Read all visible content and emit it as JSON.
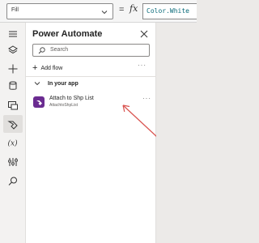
{
  "formula_bar": {
    "property": "Fill",
    "equals": "=",
    "fx": "fx",
    "formula": "Color.White"
  },
  "rail": {
    "items": [
      {
        "name": "tree-view-icon"
      },
      {
        "name": "layers-icon"
      },
      {
        "name": "insert-icon"
      },
      {
        "name": "data-icon"
      },
      {
        "name": "media-icon"
      },
      {
        "name": "power-automate-icon",
        "active": true
      },
      {
        "name": "variables-icon"
      },
      {
        "name": "advanced-tools-icon"
      },
      {
        "name": "search-icon"
      }
    ]
  },
  "pane": {
    "title": "Power Automate",
    "search_placeholder": "Search",
    "add_flow_label": "Add flow",
    "more_label": "···",
    "section_label": "In your app",
    "flow": {
      "name": "Attach to Shp List",
      "subtitle": "AttachtoShpList",
      "more_label": "···"
    }
  },
  "colors": {
    "accent": "#6b2c91",
    "annotation_arrow": "#d9534f",
    "formula_text": "#0a6b7a"
  }
}
